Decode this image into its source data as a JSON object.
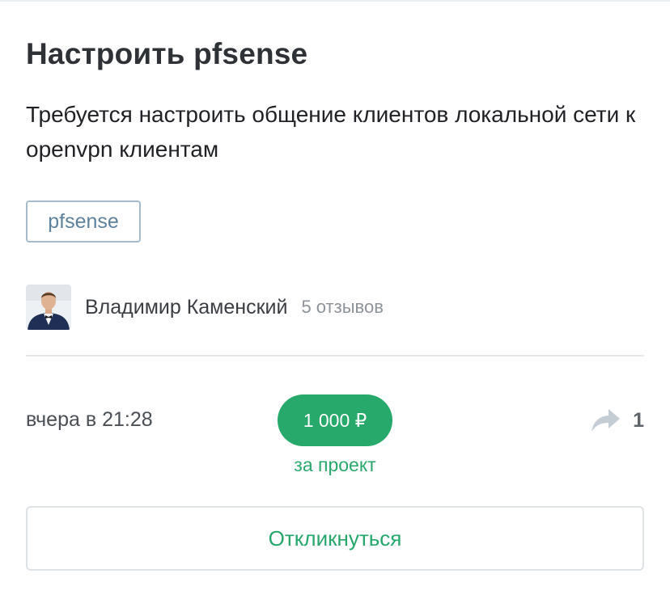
{
  "task": {
    "title": "Настроить pfsense",
    "description": "Требуется настроить общение клиентов локальной сети к openvpn клиентам",
    "tags": [
      "pfsense"
    ]
  },
  "author": {
    "name": "Владимир Каменский",
    "reviews": "5 отзывов",
    "avatar_icon": "user-avatar-photo"
  },
  "meta": {
    "date": "вчера в 21:28",
    "price": "1 000 ₽",
    "price_note": "за проект",
    "share_icon": "share-arrow-icon",
    "share_count": "1"
  },
  "actions": {
    "respond_label": "Откликнуться"
  },
  "colors": {
    "accent_green": "#26a96a",
    "tag_border": "#a6bccb",
    "tag_text": "#5e829d",
    "share_icon": "#c4ccd4"
  }
}
